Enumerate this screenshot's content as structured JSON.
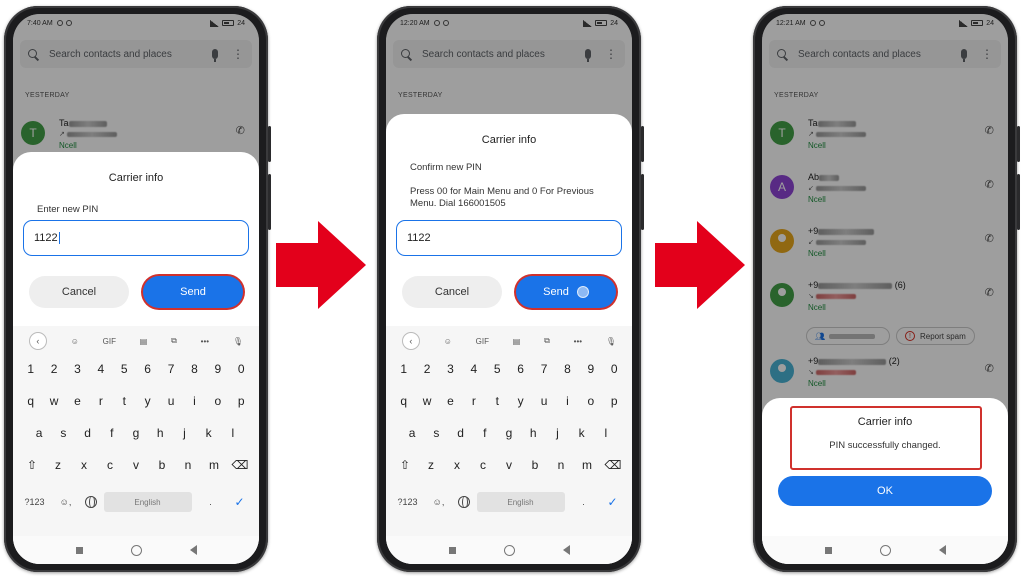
{
  "search": {
    "placeholder": "Search contacts and places"
  },
  "section_label": "YESTERDAY",
  "phones": [
    {
      "time": "7:40 AM",
      "battery": "24",
      "contact_initial": "T",
      "contact_name_start": "Ta",
      "contact_carrier": "Ncell",
      "dialog": {
        "title": "Carrier info",
        "prompt": "Enter new PIN",
        "pin": "1122",
        "cancel": "Cancel",
        "send": "Send"
      }
    },
    {
      "time": "12:20 AM",
      "battery": "24",
      "dialog": {
        "title": "Carrier info",
        "line1": "Confirm new PIN",
        "line2": "Press  00 for Main Menu and 0 For Previous Menu. Dial 166001505",
        "pin": "1122",
        "cancel": "Cancel",
        "send": "Send"
      }
    },
    {
      "time": "12:21 AM",
      "battery": "24",
      "contacts": [
        {
          "initial": "T",
          "name_start": "Ta",
          "carrier": "Ncell",
          "color": "#43a047"
        },
        {
          "initial": "A",
          "name_start": "Ab",
          "carrier": "Ncell",
          "color": "#8e44d6"
        },
        {
          "initial": "",
          "name_start": "+9",
          "carrier": "Ncell",
          "color": "#e8a81c"
        },
        {
          "initial": "",
          "name_start": "+9",
          "count": "(6)",
          "carrier": "Ncell",
          "color": "#43a047"
        },
        {
          "initial": "",
          "name_start": "+9",
          "count": "(2)",
          "carrier": "Ncell",
          "color": "#4ab3d6"
        }
      ],
      "report_spam": "Report spam",
      "dialog": {
        "title": "Carrier info",
        "message": "PIN successfully changed.",
        "ok": "OK"
      }
    }
  ],
  "keyboard": {
    "tools": [
      "GIF"
    ],
    "numbers": [
      "1",
      "2",
      "3",
      "4",
      "5",
      "6",
      "7",
      "8",
      "9",
      "0"
    ],
    "row1": [
      "q",
      "w",
      "e",
      "r",
      "t",
      "y",
      "u",
      "i",
      "o",
      "p"
    ],
    "row2": [
      "a",
      "s",
      "d",
      "f",
      "g",
      "h",
      "j",
      "k",
      "l"
    ],
    "row3": [
      "z",
      "x",
      "c",
      "v",
      "b",
      "n",
      "m"
    ],
    "symbols_key": "?123",
    "space_label": "English",
    "period": "."
  },
  "colors": {
    "accent": "#1a73e8",
    "highlight": "#d0312d",
    "arrow": "#e3001b"
  }
}
